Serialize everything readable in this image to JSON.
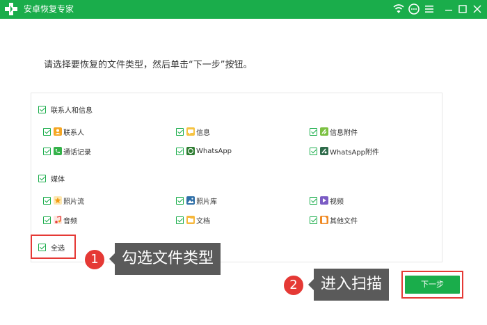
{
  "app": {
    "title": "安卓恢复专家"
  },
  "instruction": "请选择要恢复的文件类型，然后单击“下一步”按钮。",
  "groups": {
    "contacts_info": {
      "label": "联系人和信息",
      "items": [
        "联系人",
        "信息",
        "信息附件",
        "通话记录",
        "WhatsApp",
        "WhatsApp附件"
      ]
    },
    "media": {
      "label": "媒体",
      "items": [
        "照片流",
        "照片库",
        "视频",
        "音频",
        "文档",
        "其他文件"
      ]
    }
  },
  "select_all": "全选",
  "next_button": "下一步",
  "callouts": [
    {
      "number": "1",
      "text": "勾选文件类型"
    },
    {
      "number": "2",
      "text": "进入扫描"
    }
  ],
  "colors": {
    "brand_green": "#1aad4b",
    "highlight_red": "#e53935",
    "callout_gray": "#5a5a5a"
  },
  "icons": [
    "app-plus-logo-icon",
    "wifi-icon",
    "chat-icon",
    "menu-icon",
    "minimize-icon",
    "maximize-icon",
    "close-icon"
  ]
}
